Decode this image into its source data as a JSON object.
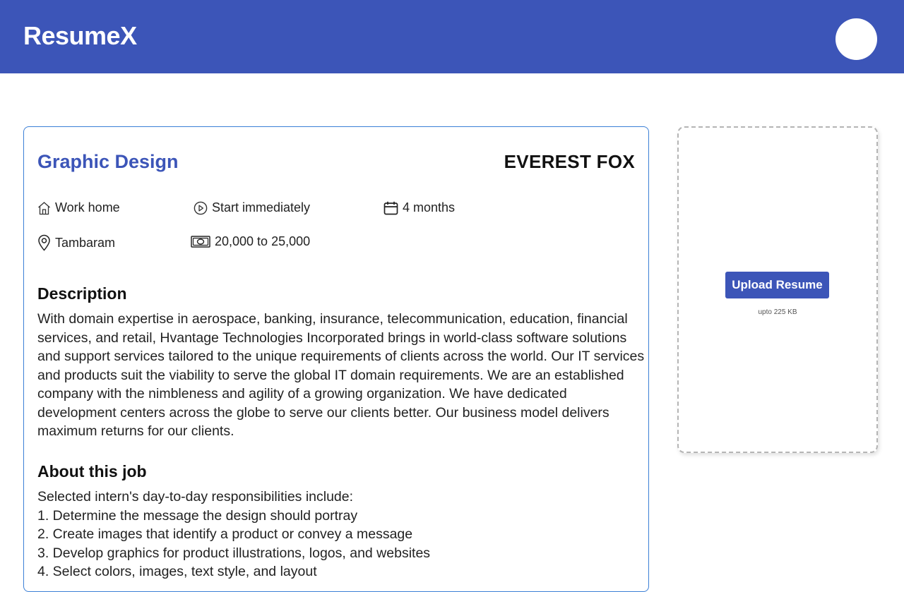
{
  "header": {
    "brand": "ResumeX",
    "bg_color": "#3c55b8"
  },
  "job": {
    "title": "Graphic Design",
    "company": "EVEREST FOX",
    "meta": {
      "work_type": "Work home",
      "start": "Start immediately",
      "duration": "4 months",
      "location": "Tambaram",
      "stipend": "20,000 to 25,000"
    },
    "description_heading": "Description",
    "description": "With domain expertise in aerospace, banking, insurance, telecommunication, education, financial services, and retail, Hvantage Technologies Incorporated brings in world-class software solutions and support services tailored to the unique requirements of clients across the world. Our IT services and products suit the viability to serve the global IT domain requirements. We are an established company with the nimbleness and agility of a growing organization. We have dedicated development centers across the globe to serve our clients better. Our business model delivers maximum returns for our clients.",
    "about_heading": "About this job",
    "about_lines": [
      "Selected intern's day-to-day responsibilities include:",
      "1. Determine the message the design should portray",
      "2. Create images that identify a product or convey a message",
      "3. Develop graphics for product illustrations, logos, and websites",
      "4. Select colors, images, text style, and layout"
    ]
  },
  "upload": {
    "button_label": "Upload Resume",
    "note": "upto 225 KB"
  },
  "icons": [
    "home-icon",
    "play-circle-icon",
    "calendar-icon",
    "location-pin-icon",
    "money-icon"
  ],
  "colors": {
    "accent": "#3c55b8",
    "card_border": "#3b7fd6"
  }
}
